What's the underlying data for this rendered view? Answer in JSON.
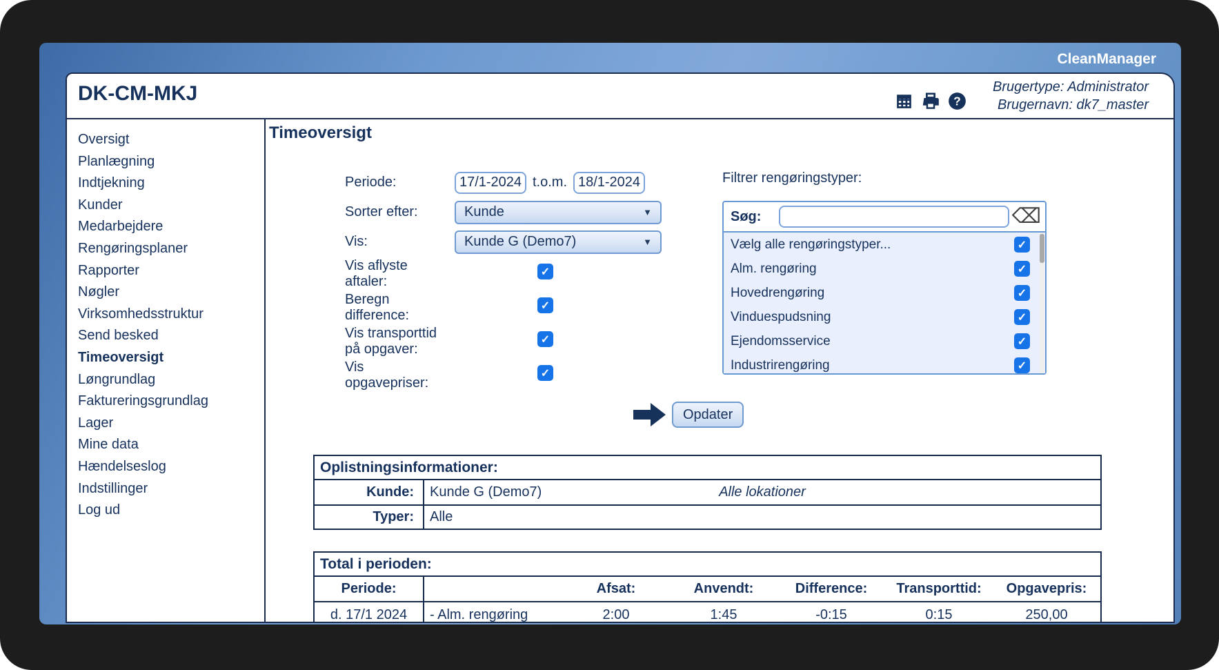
{
  "frame": {
    "brand": "CleanManager"
  },
  "header": {
    "title": "DK-CM-MKJ",
    "user_type_label": "Brugertype: Administrator",
    "user_name_label": "Brugernavn: dk7_master"
  },
  "sidebar": {
    "items": [
      {
        "label": "Oversigt"
      },
      {
        "label": "Planlægning"
      },
      {
        "label": "Indtjekning"
      },
      {
        "label": "Kunder"
      },
      {
        "label": "Medarbejdere"
      },
      {
        "label": "Rengøringsplaner"
      },
      {
        "label": "Rapporter"
      },
      {
        "label": "Nøgler"
      },
      {
        "label": "Virksomhedsstruktur"
      },
      {
        "label": "Send besked"
      },
      {
        "label": "Timeoversigt",
        "active": true
      },
      {
        "label": "Løngrundlag"
      },
      {
        "label": "Faktureringsgrundlag"
      },
      {
        "label": "Lager"
      },
      {
        "label": "Mine data"
      },
      {
        "label": "Hændelseslog"
      },
      {
        "label": "Indstillinger"
      },
      {
        "label": "Log ud"
      }
    ]
  },
  "main": {
    "title": "Timeoversigt",
    "form": {
      "periode_label": "Periode:",
      "date_from": "17/1-2024",
      "tom_label": "t.o.m.",
      "date_to": "18/1-2024",
      "sorter_label": "Sorter efter:",
      "sorter_value": "Kunde",
      "vis_label": "Vis:",
      "vis_value": "Kunde G (Demo7)",
      "checkboxes": [
        {
          "label": "Vis aflyste aftaler:",
          "checked": true
        },
        {
          "label": "Beregn difference:",
          "checked": true
        },
        {
          "label": "Vis transporttid på opgaver:",
          "checked": true
        },
        {
          "label": "Vis opgavepriser:",
          "checked": true
        }
      ]
    },
    "filter": {
      "title": "Filtrer rengøringstyper:",
      "search_label": "Søg:",
      "search_value": "",
      "items": [
        {
          "label": "Vælg alle rengøringstyper...",
          "checked": true
        },
        {
          "label": "Alm. rengøring",
          "checked": true
        },
        {
          "label": "Hovedrengøring",
          "checked": true
        },
        {
          "label": "Vinduespudsning",
          "checked": true
        },
        {
          "label": "Ejendomsservice",
          "checked": true
        },
        {
          "label": "Industrirengøring",
          "checked": true
        }
      ]
    },
    "update_button": "Opdater",
    "info_table": {
      "title": "Oplistningsinformationer:",
      "rows": [
        {
          "label": "Kunde:",
          "value": "Kunde G (Demo7)",
          "note": "Alle lokationer"
        },
        {
          "label": "Typer:",
          "value": "Alle",
          "note": ""
        }
      ]
    },
    "total_table": {
      "title": "Total i perioden:",
      "columns": [
        "Periode:",
        "",
        "Afsat:",
        "Anvendt:",
        "Difference:",
        "Transporttid:",
        "Opgavepris:"
      ],
      "rows": [
        {
          "periode": "d. 17/1 2024",
          "beskrivelse": "- Alm. rengøring",
          "afsat": "2:00",
          "anvendt": "1:45",
          "difference": "-0:15",
          "transporttid": "0:15",
          "opgavepris": "250,00"
        }
      ]
    }
  },
  "icons": {
    "checkmark": "✓",
    "clear_search": "⌫",
    "dropdown_arrow": "▼"
  },
  "colors": {
    "accent_navy": "#16315c",
    "checkbox_blue": "#1774e8",
    "panel_blue": "#6c99cf"
  }
}
